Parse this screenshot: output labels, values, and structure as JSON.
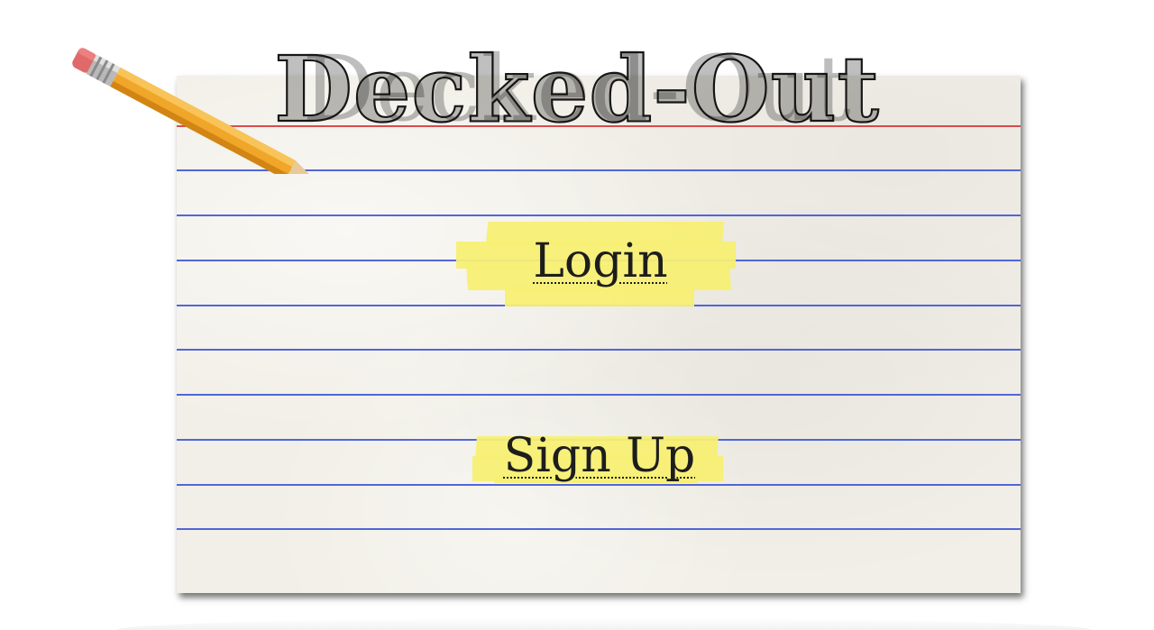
{
  "app": {
    "title": "Decked-Out"
  },
  "actions": {
    "login_label": "Login",
    "signup_label": "Sign Up"
  },
  "decor": {
    "pencil": "pencil-icon",
    "card": "ruled-index-card"
  },
  "colors": {
    "card_paper": "#f1efe7",
    "rule_blue": "#3f56d6",
    "rule_red": "#d63a3a",
    "highlighter": "#f7ef74",
    "ink": "#1d1d1d",
    "pencil_body": "#f0a628",
    "pencil_eraser": "#e06a6a"
  }
}
